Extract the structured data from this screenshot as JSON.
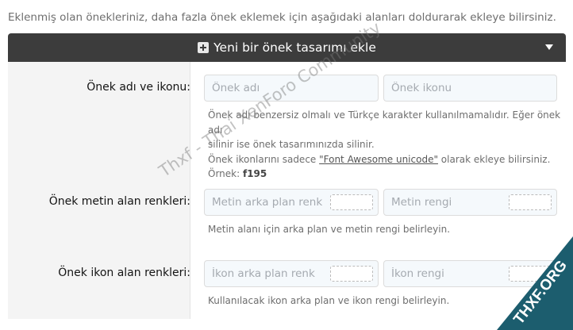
{
  "intro_text": "Eklenmiş olan önekleriniz, daha fazla önek eklemek için aşağıdaki alanları doldurarak ekleye bilirsiniz.",
  "header": {
    "title": "Yeni bir önek tasarımı ekle",
    "icons": [
      "plus-square-icon",
      "caret-down-icon"
    ]
  },
  "rows": {
    "name": {
      "label": "Önek adı ve ikonu:",
      "name_placeholder": "Önek adı",
      "icon_placeholder": "Önek ikonu",
      "hint_1": "Önek adı benzersiz olmalı ve Türkçe karakter kullanılmamalıdır. Eğer önek adı",
      "hint_2": "silinir ise önek tasarımınızda silinir.",
      "hint_3_pre": "Önek ikonlarını sadece ",
      "hint_3_link": "\"Font Awesome unicode\"",
      "hint_3_post": " olarak ekleye bilirsiniz.",
      "example_label": "Örnek: ",
      "example_value": "f195"
    },
    "text_colors": {
      "label": "Önek metin alan renkleri:",
      "bg_placeholder": "Metin arka plan renk",
      "color_placeholder": "Metin rengi",
      "hint": "Metin alanı için arka plan ve metin rengi belirleyin."
    },
    "icon_colors": {
      "label": "Önek ikon alan renkleri:",
      "bg_placeholder": "İkon arka plan renk",
      "color_placeholder": "İkon rengi",
      "hint": "Kullanılacak ikon arka plan ve ikon rengi belirleyin."
    }
  },
  "watermark": {
    "text": "Thxf - Thai XenForo Community",
    "badge": "THXF.ORG"
  },
  "colors": {
    "header_bg": "#3c3c3c",
    "label_col_bg": "#f4f4f4",
    "badge_bg": "#1c5d6e"
  }
}
